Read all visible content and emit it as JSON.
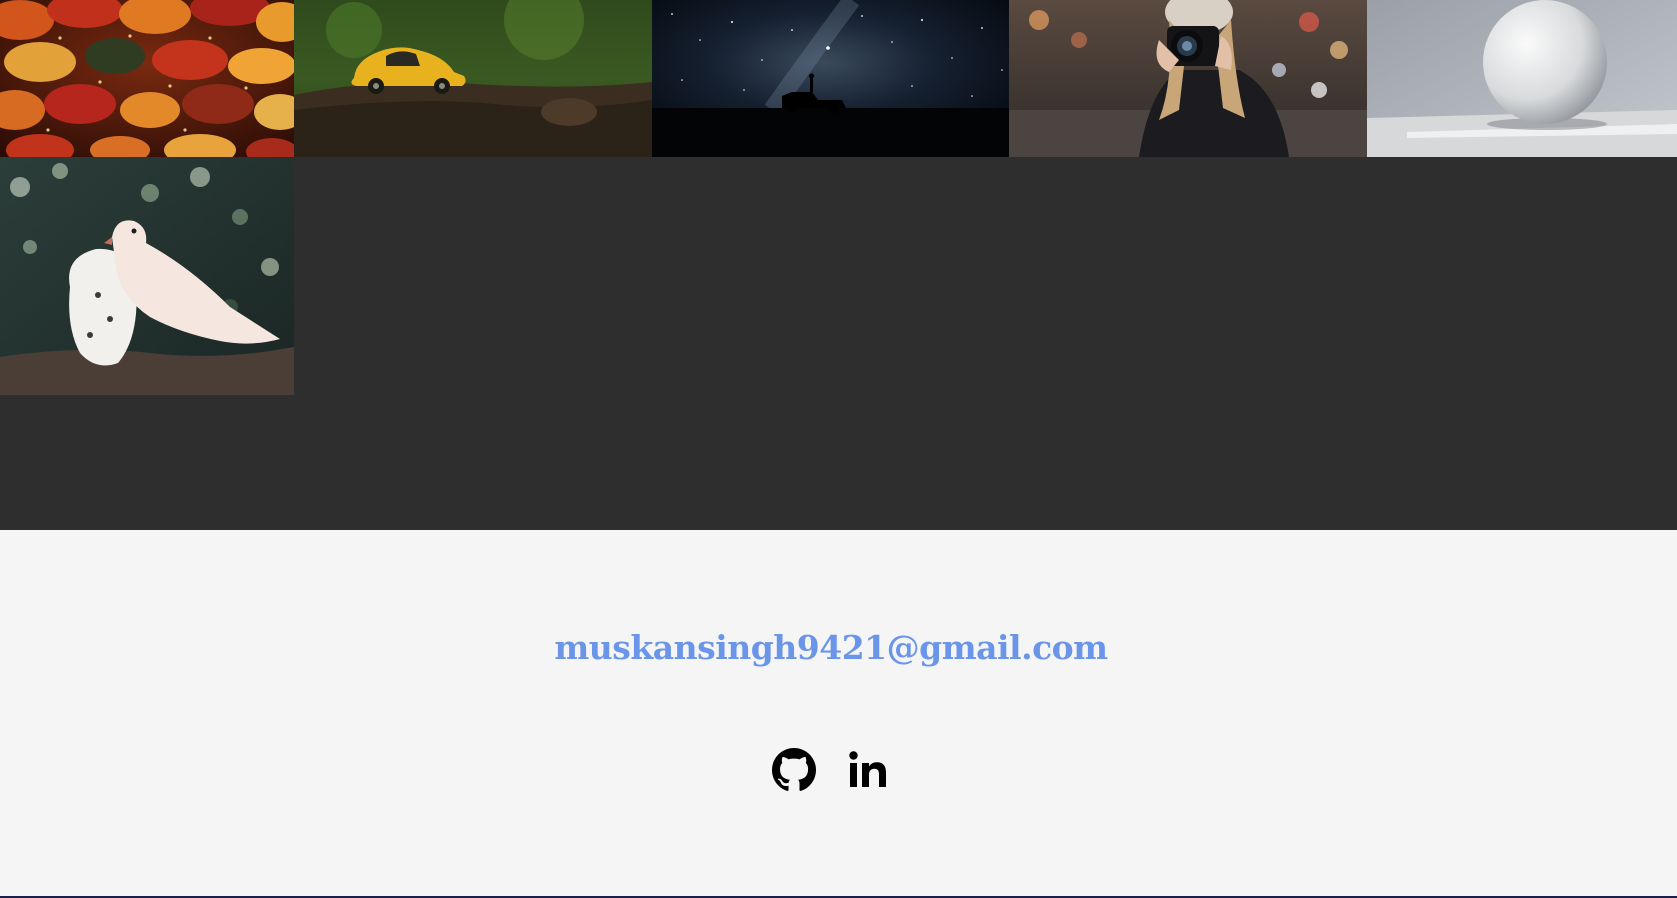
{
  "gallery": {
    "photos": [
      {
        "subject": "umbrellas"
      },
      {
        "subject": "yellow-toy-car"
      },
      {
        "subject": "night-sky-milky-way"
      },
      {
        "subject": "photographer-with-camera"
      },
      {
        "subject": "white-sphere"
      },
      {
        "subject": "white-doves"
      }
    ]
  },
  "footer": {
    "email": "muskansingh9421@gmail.com",
    "email_color": "#6b95e8",
    "social": [
      {
        "icon": "github-icon"
      },
      {
        "icon": "linkedin-icon"
      }
    ]
  },
  "colors": {
    "gallery_background": "#2e2e2e",
    "footer_background": "#f5f5f5"
  }
}
